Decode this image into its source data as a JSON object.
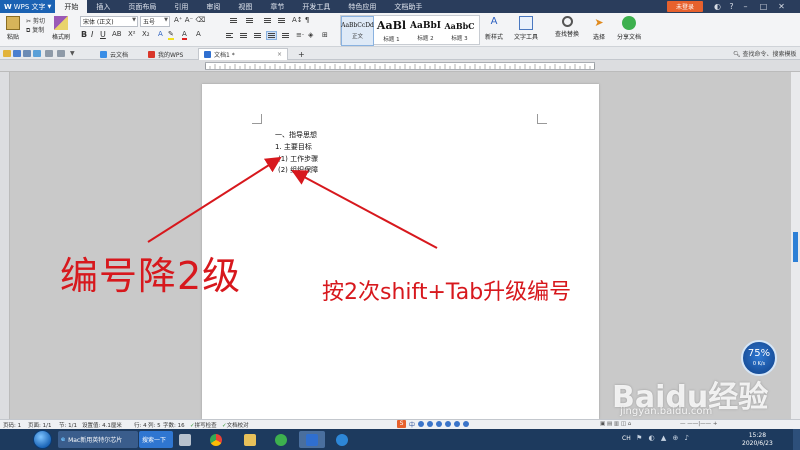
{
  "titlebar": {
    "app_name": "WPS 文字",
    "tabs": [
      "开始",
      "插入",
      "页面布局",
      "引用",
      "审阅",
      "视图",
      "章节",
      "开发工具",
      "特色应用",
      "文档助手"
    ],
    "active_tab": "开始",
    "login_label": "未登录"
  },
  "ribbon": {
    "paste": "粘贴",
    "cut": "剪切",
    "copy": "复制",
    "format_painter": "格式刷",
    "font_name": "宋体 (正文)",
    "font_size": "五号",
    "styles": [
      {
        "preview": "AaBbCcDd",
        "name": "正文"
      },
      {
        "preview": "AaBl",
        "name": "标题 1"
      },
      {
        "preview": "AaBbI",
        "name": "标题 2"
      },
      {
        "preview": "AaBbC",
        "name": "标题 3"
      }
    ],
    "new_style": "新样式",
    "text_tools": "文字工具",
    "find_replace": "查找替换",
    "select": "选择",
    "share_doc": "分享文档"
  },
  "doc_tabs": {
    "tabs": [
      {
        "label": "云文档",
        "icon_color": "#3a8ee6"
      },
      {
        "label": "我的WPS",
        "icon_color": "#d9362a"
      },
      {
        "label": "文档1 *",
        "icon_color": "#2f6fd0"
      }
    ],
    "search_cmd": "查找命令、搜索模板"
  },
  "document": {
    "lines": [
      "一、指导思想",
      "1. 主要目标",
      "(1) 工作步骤",
      "(2) 组织保障"
    ]
  },
  "annotations": {
    "left": "编号降2级",
    "right": "按2次shift+Tab升级编号"
  },
  "statusbar": {
    "page_num": "页码: 1",
    "pages": "页面: 1/1",
    "section": "节: 1/1",
    "setting": "设置值: 4.1厘米",
    "row": "行: 4",
    "col": "列: 5",
    "words": "字数: 16",
    "spell_check": "拼写检查",
    "doc_check": "文档校对"
  },
  "taskbar": {
    "task_title": "Mac新用英特尔芯片",
    "search_button": "搜索一下",
    "lang": "CH",
    "time": "15:28",
    "date": "2020/6/23"
  },
  "speed_widget": {
    "percent": "75%",
    "rate": "0 K/s"
  },
  "watermark": {
    "brand": "Baidu经验",
    "url": "jingyan.baidu.com"
  },
  "ime": {
    "logo": "S",
    "mode": "中"
  },
  "colors": {
    "accent_red": "#d7181d",
    "title_blue": "#2a3d5c",
    "login_orange": "#e7612d"
  }
}
